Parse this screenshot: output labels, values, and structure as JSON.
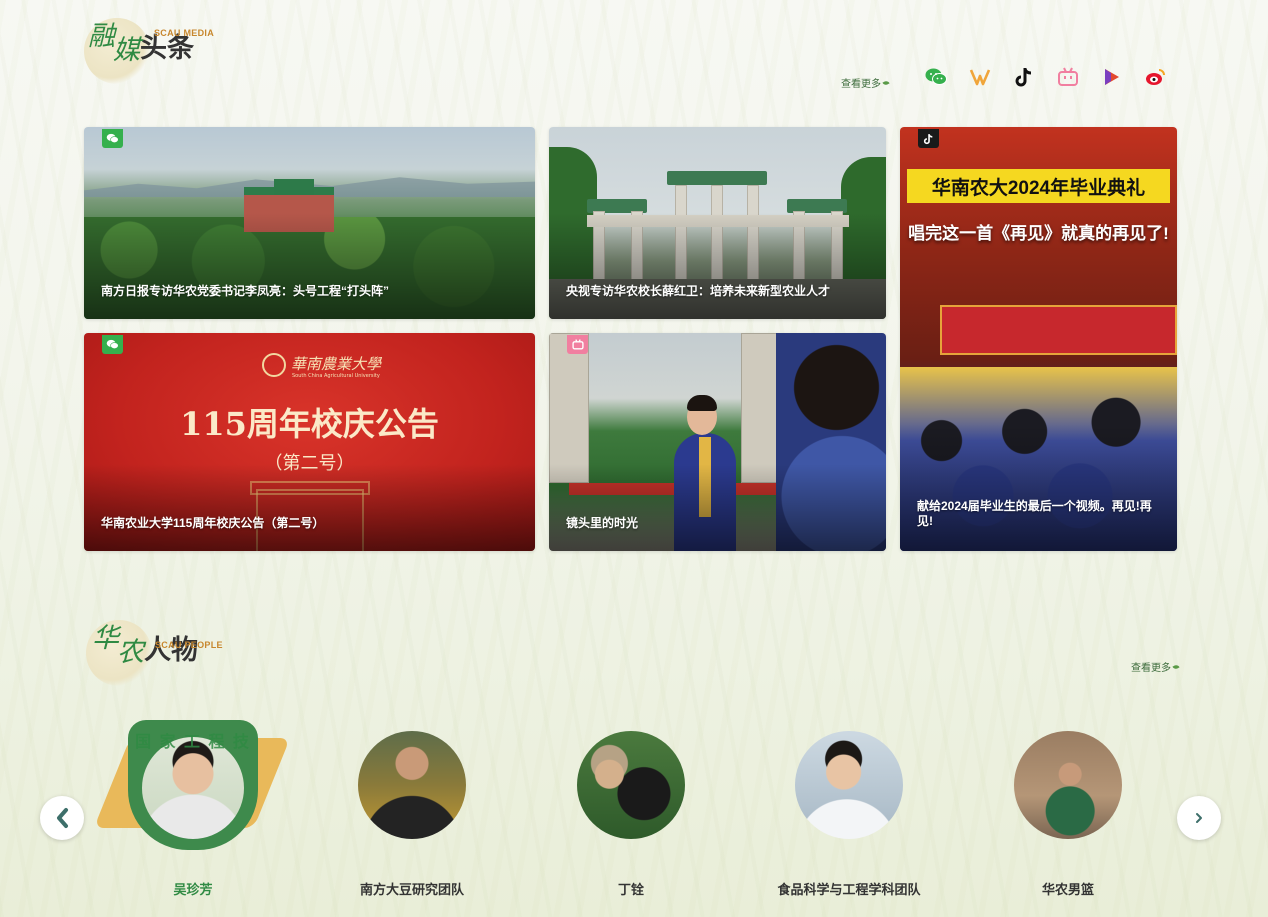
{
  "media": {
    "logo": {
      "cal1": "融",
      "cal2": "媒",
      "main": "头条",
      "en": "SCAU MEDIA"
    },
    "more_label": "查看更多",
    "socials": [
      {
        "name": "wechat-icon",
        "color": "#35b04d"
      },
      {
        "name": "weishi-icon",
        "color": "#f0a53a"
      },
      {
        "name": "tiktok-icon",
        "color": "#111111"
      },
      {
        "name": "bilibili-icon",
        "color": "#f17fa0"
      },
      {
        "name": "video-icon",
        "color": "#e2492f"
      },
      {
        "name": "weibo-icon",
        "color": "#e6162d"
      }
    ],
    "cards": [
      {
        "platform": "wechat",
        "caption": "南方日报专访华农党委书记李凤亮：头号工程“打头阵”"
      },
      {
        "platform": "none",
        "caption": "央视专访华农校长薛红卫：培养未来新型农业人才"
      },
      {
        "platform": "tiktok",
        "caption": "献给2024届毕业生的最后一个视频。再见!再见!",
        "overlay_title": "华南农大2024年毕业典礼",
        "overlay_sub": "唱完这一首《再见》就真的再见了!"
      },
      {
        "platform": "wechat",
        "caption": "华南农业大学115周年校庆公告（第二号）",
        "poster_school": "華南農業大學",
        "poster_school_en": "South China Agricultural University",
        "poster_title": "115周年校庆公告",
        "poster_sub": "（第二号）"
      },
      {
        "platform": "bilibili",
        "caption": "镜头里的时光"
      }
    ]
  },
  "people": {
    "logo": {
      "cal1": "华",
      "cal2": "农",
      "main": "人物",
      "en": "SCAU PEOPLE"
    },
    "more_label": "查看更多",
    "active_board_text": "国 家 工 程 技",
    "list": [
      {
        "name": "吴珍芳",
        "active": true
      },
      {
        "name": "南方大豆研究团队",
        "active": false
      },
      {
        "name": "丁铨",
        "active": false
      },
      {
        "name": "食品科学与工程学科团队",
        "active": false
      },
      {
        "name": "华农男篮",
        "active": false
      }
    ]
  },
  "accent": "#2f8a43"
}
